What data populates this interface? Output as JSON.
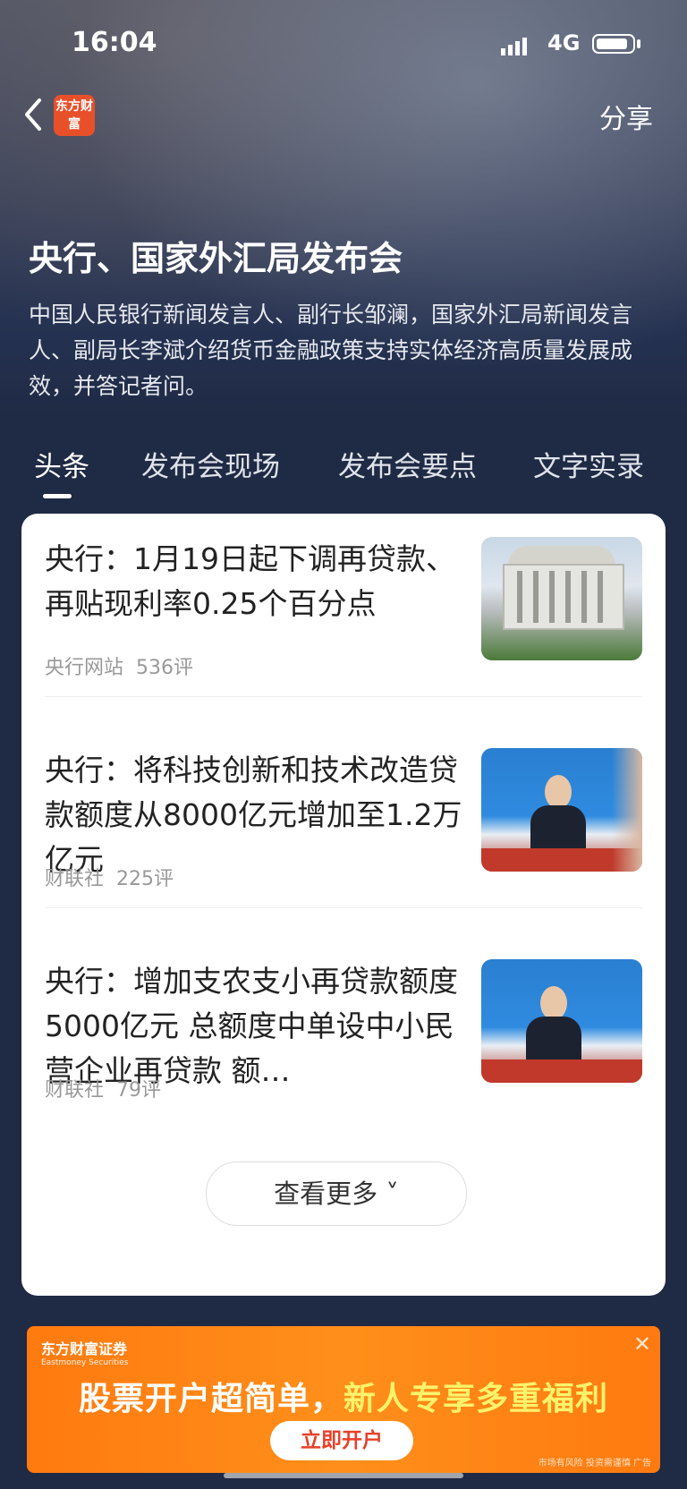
{
  "status_bar": {
    "time": "16:04",
    "network": "4G"
  },
  "header": {
    "logo_text": "东方财富",
    "share_label": "分享"
  },
  "event": {
    "title": "央行、国家外汇局发布会",
    "description": "中国人民银行新闻发言人、副行长邹澜，国家外汇局新闻发言人、副局长李斌介绍货币金融政策支持实体经济高质量发展成效，并答记者问。"
  },
  "tabs": [
    {
      "label": "头条",
      "active": true
    },
    {
      "label": "发布会现场",
      "active": false
    },
    {
      "label": "发布会要点",
      "active": false
    },
    {
      "label": "文字实录",
      "active": false
    }
  ],
  "news": [
    {
      "title": "央行：1月19日起下调再贷款、再贴现利率0.25个百分点",
      "source": "央行网站",
      "comments": "536评",
      "thumbnail": "central-bank-building"
    },
    {
      "title": "央行：将科技创新和技术改造贷款额度从8000亿元增加至1.2万亿元",
      "source": "财联社",
      "comments": "225评",
      "thumbnail": "press-conference-speaker"
    },
    {
      "title": "央行：增加支农支小再贷款额度5000亿元 总额度中单设中小民营企业再贷款 额…",
      "source": "财联社",
      "comments": "79评",
      "thumbnail": "press-conference-speaker"
    }
  ],
  "more_button": {
    "label": "查看更多 ˅"
  },
  "ad": {
    "brand": "东方财富证券",
    "brand_en": "Eastmoney Securities",
    "slogan_part1": "股票开户超简单，",
    "slogan_part2": "新人专享多重福利",
    "cta": "立即开户",
    "disclaimer": "市场有风险 投资需谨慎 广告"
  },
  "colors": {
    "accent": "#e8502a",
    "background": "#1f2a44",
    "ad": "#ff7a10"
  }
}
